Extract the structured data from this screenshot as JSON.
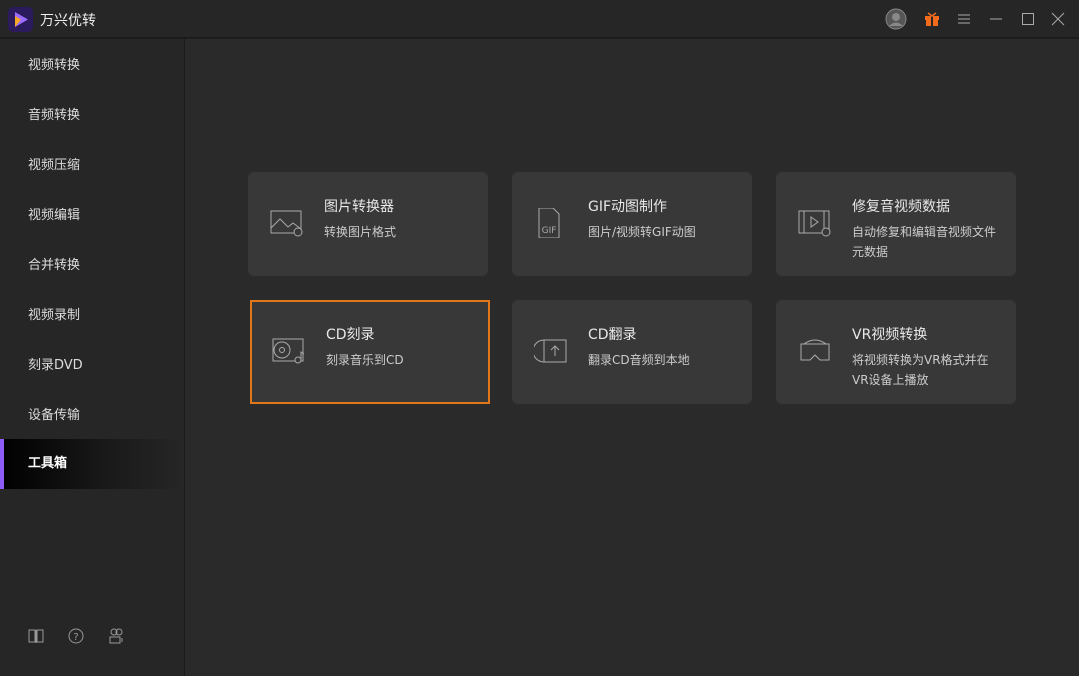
{
  "app": {
    "title": "万兴优转"
  },
  "sidebar": {
    "items": [
      {
        "label": "视频转换"
      },
      {
        "label": "音频转换"
      },
      {
        "label": "视频压缩"
      },
      {
        "label": "视频编辑"
      },
      {
        "label": "合并转换"
      },
      {
        "label": "视频录制"
      },
      {
        "label": "刻录DVD"
      },
      {
        "label": "设备传输"
      },
      {
        "label": "工具箱",
        "active": true
      }
    ]
  },
  "tools": [
    {
      "title": "图片转换器",
      "desc": "转换图片格式",
      "icon": "image-convert-icon"
    },
    {
      "title": "GIF动图制作",
      "desc": "图片/视频转GIF动图",
      "icon": "gif-icon"
    },
    {
      "title": "修复音视频数据",
      "desc": "自动修复和编辑音视频文件元数据",
      "icon": "metadata-icon"
    },
    {
      "title": "CD刻录",
      "desc": "刻录音乐到CD",
      "icon": "cd-burn-icon",
      "selected": true
    },
    {
      "title": "CD翻录",
      "desc": "翻录CD音频到本地",
      "icon": "cd-rip-icon"
    },
    {
      "title": "VR视频转换",
      "desc": "将视频转换为VR格式并在VR设备上播放",
      "icon": "vr-icon"
    }
  ],
  "colors": {
    "accent": "#8b5cf6",
    "selection": "#e2771a",
    "gift": "#f26b1d"
  }
}
